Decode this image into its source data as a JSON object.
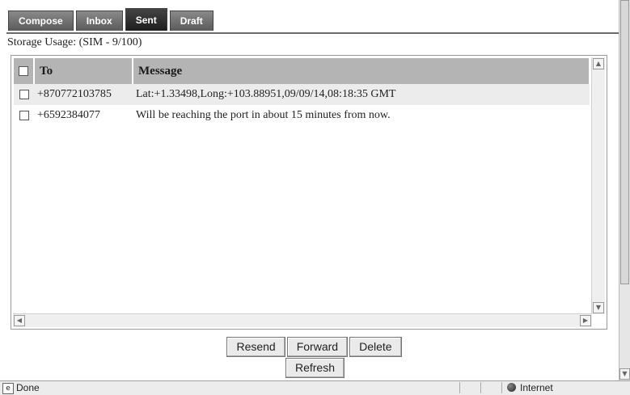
{
  "tabs": [
    {
      "label": "Compose"
    },
    {
      "label": "Inbox"
    },
    {
      "label": "Sent"
    },
    {
      "label": "Draft"
    }
  ],
  "active_tab": "Sent",
  "storage_usage": "Storage Usage: (SIM - 9/100)",
  "table": {
    "columns": {
      "to": "To",
      "message": "Message"
    },
    "rows": [
      {
        "to": "+870772103785",
        "message": "Lat:+1.33498,Long:+103.88951,09/09/14,08:18:35 GMT"
      },
      {
        "to": "+6592384077",
        "message": "Will be reaching the port in about 15 minutes from now."
      }
    ]
  },
  "actions": {
    "resend": "Resend",
    "forward": "Forward",
    "delete": "Delete",
    "refresh": "Refresh"
  },
  "statusbar": {
    "status": "Done",
    "zone": "Internet"
  },
  "colors": {
    "header_bg": "#b4b4b4",
    "tab_active_bg": "#1e1e1e",
    "tab_bg": "#6a6a6a"
  }
}
